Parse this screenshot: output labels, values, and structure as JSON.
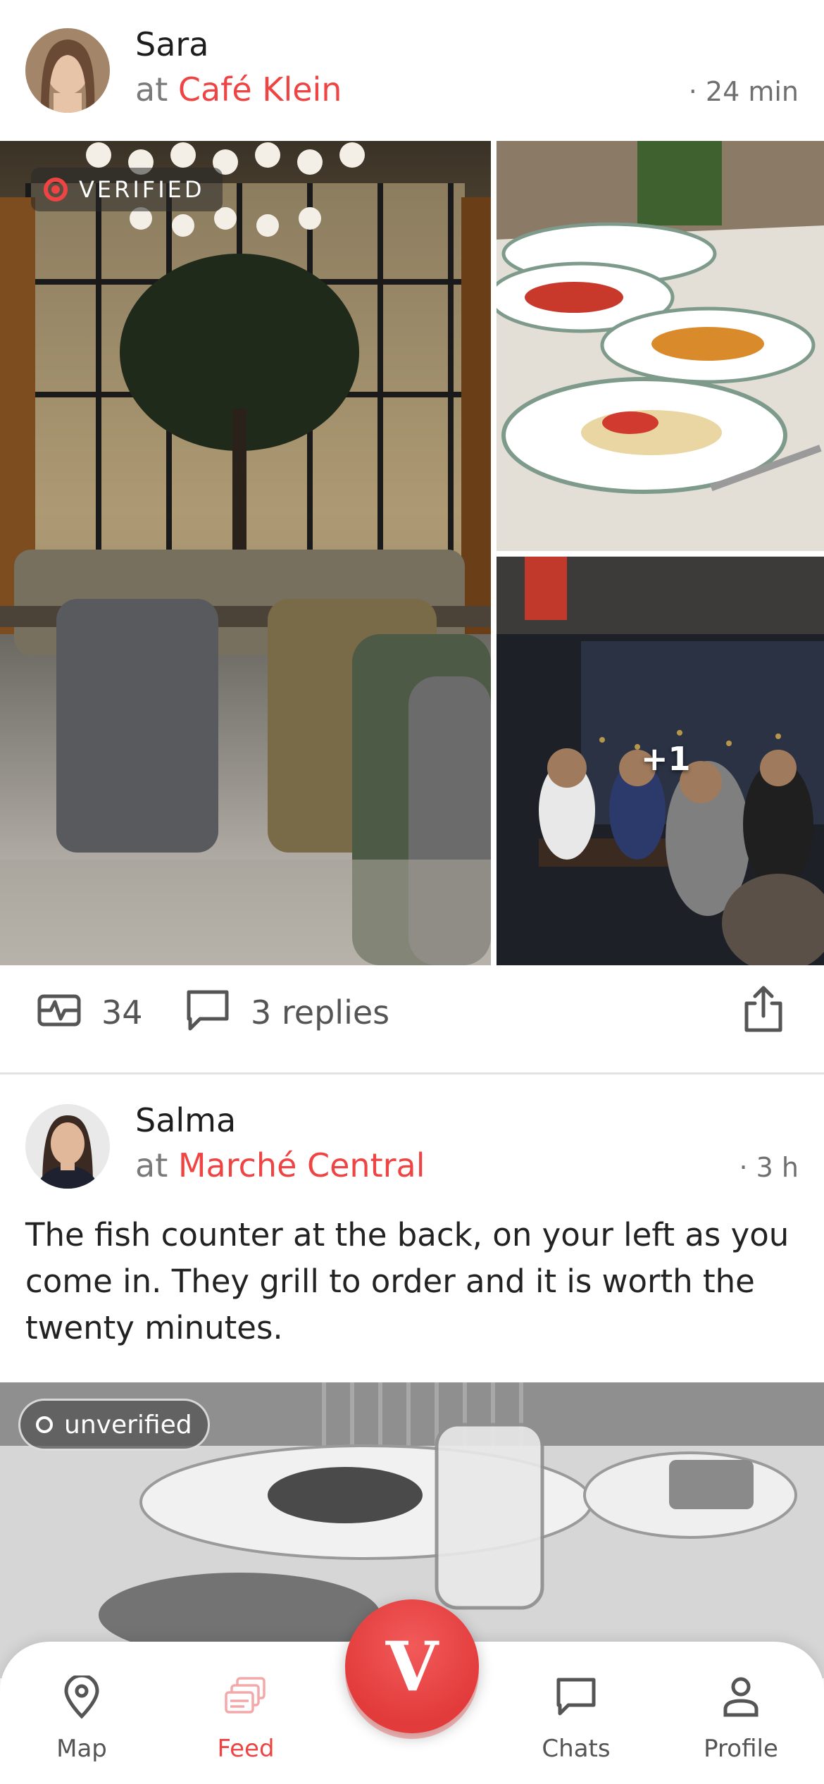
{
  "posts": [
    {
      "username": "Sara",
      "at": "at",
      "place": "Café Klein",
      "time": "· 24 min",
      "badge": "VERIFIED",
      "extra_photos": "+1",
      "likes": "34",
      "replies": "3 replies",
      "icons": {
        "likes": "activity-icon",
        "replies": "comment-icon",
        "share": "share-icon",
        "badge": "verified-ring-icon"
      }
    },
    {
      "username": "Salma",
      "at": "at",
      "place": "Marché Central",
      "time": "· 3 h",
      "text": "The fish counter at the back, on your left as you come in. They grill to order and it is worth the twenty minutes.",
      "badge": "unverified"
    }
  ],
  "tabs": [
    {
      "label": "Map",
      "icon": "map-pin-icon"
    },
    {
      "label": "Feed",
      "icon": "feed-stack-icon",
      "active": true
    },
    {
      "label": "Chats",
      "icon": "chat-icon"
    },
    {
      "label": "Profile",
      "icon": "person-icon"
    }
  ],
  "fab": {
    "label": "V",
    "icon": "app-logo-v"
  },
  "colors": {
    "accent": "#ee4444",
    "text": "#222222",
    "muted": "#7a7a7a",
    "divider": "#e3e3e3"
  }
}
